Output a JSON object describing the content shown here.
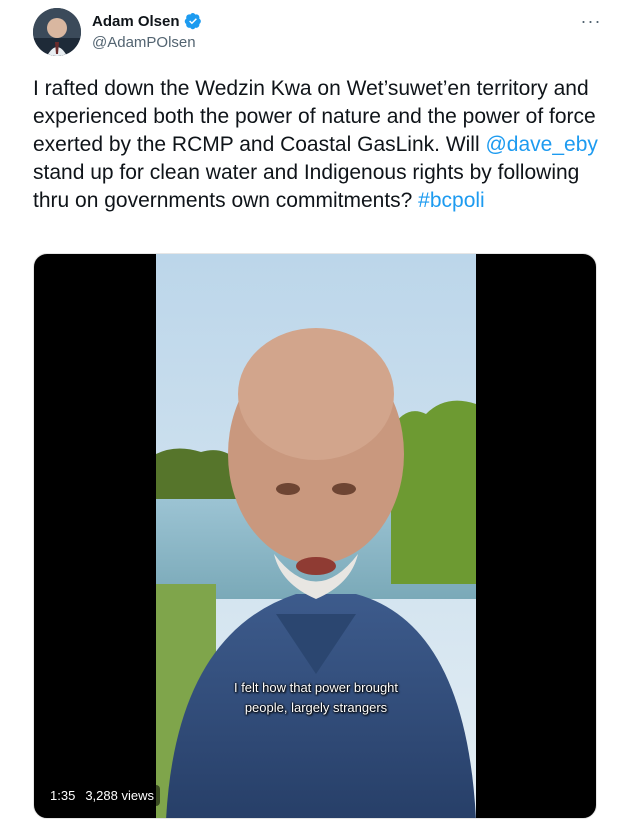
{
  "author": {
    "name": "Adam Olsen",
    "handle": "@AdamPOlsen",
    "verified": true,
    "avatar_icon": "profile-photo"
  },
  "menu_icon": "more-options-icon",
  "tweet": {
    "text_1": "I rafted down the Wedzin Kwa on Wet’suwet’en territory and experienced both the power of nature and the power of force exerted by the RCMP and Coastal GasLink. Will ",
    "mention": "@dave_eby",
    "text_2": " stand up for clean water and Indigenous rights by following thru on governments own commitments? ",
    "hashtag": "#bcpoli"
  },
  "video": {
    "caption_line1": "I felt how that power brought",
    "caption_line2": "people, largely strangers",
    "duration": "1:35",
    "views": "3,288 views"
  },
  "colors": {
    "link": "#1d9bf0",
    "verified": "#1d9bf0",
    "text": "#0f1419",
    "secondary": "#536471"
  }
}
